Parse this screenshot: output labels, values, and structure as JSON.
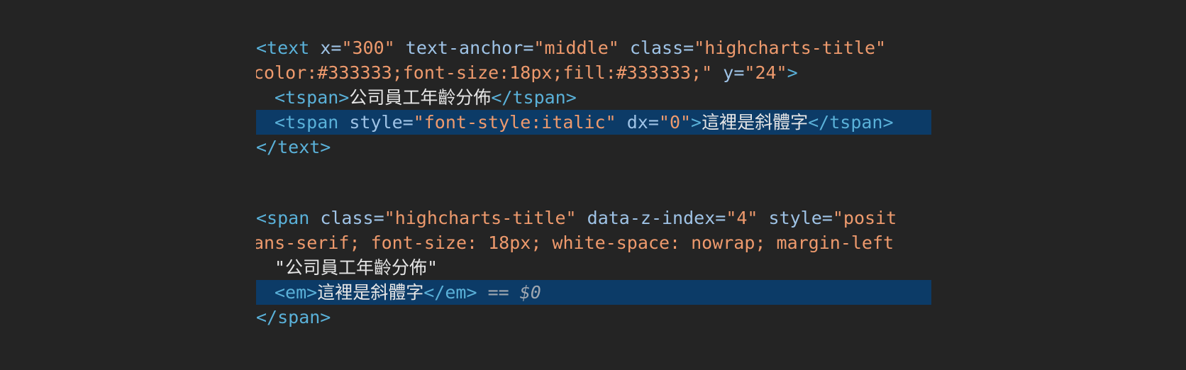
{
  "block1": {
    "line1": {
      "open": "<text",
      "attr1": "x=",
      "val1": "\"300\"",
      "attr2": "text-anchor=",
      "val2": "\"middle\"",
      "attr3": "class=",
      "val3": "\"highcharts-title\""
    },
    "line2": {
      "val": "color:#333333;font-size:18px;fill:#333333;\"",
      "attr": "y=",
      "val2": "\"24\"",
      "close": ">"
    },
    "line3": {
      "open": "<tspan>",
      "text": "公司員工年齡分佈",
      "close": "</tspan>"
    },
    "line4": {
      "open": "<tspan",
      "attr1": "style=",
      "val1": "\"font-style:italic\"",
      "attr2": "dx=",
      "val2": "\"0\"",
      "gt": ">",
      "text": "這裡是斜體字",
      "close": "</tspan>"
    },
    "line5": {
      "close": "</text>"
    }
  },
  "block2": {
    "line1": {
      "open": "<span",
      "attr1": "class=",
      "val1": "\"highcharts-title\"",
      "attr2": "data-z-index=",
      "val2": "\"4\"",
      "attr3": "style=",
      "val3": "\"posit"
    },
    "line2": {
      "val": "ans-serif; font-size: 18px; white-space: nowrap; margin-left"
    },
    "line3": {
      "text": "\"公司員工年齡分佈\""
    },
    "line4": {
      "open": "<em>",
      "text": "這裡是斜體字",
      "close": "</em>",
      "eq": "==",
      "ref": "$0"
    },
    "line5": {
      "close": "</span>"
    }
  },
  "colors": {
    "background": "#242424",
    "highlight": "#0c3b67",
    "tag": "#5ab1d9",
    "attribute": "#9fc3e6",
    "string": "#ee9a6d",
    "text": "#e6e6e6"
  }
}
